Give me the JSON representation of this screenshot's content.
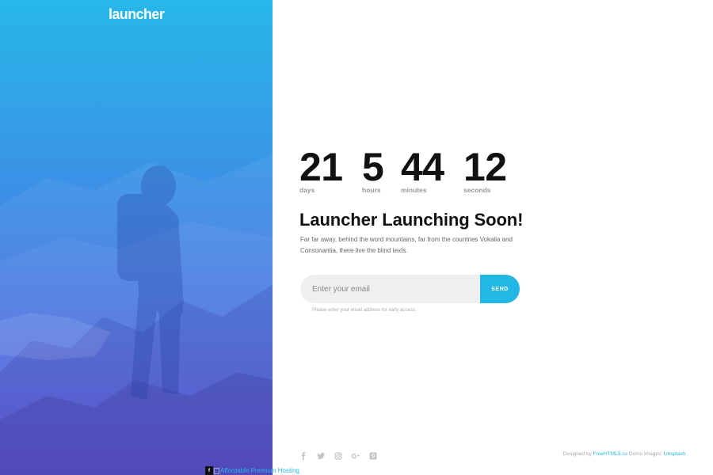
{
  "brand": {
    "logo": "launcher"
  },
  "countdown": {
    "days": {
      "value": "21",
      "label": "days"
    },
    "hours": {
      "value": "5",
      "label": "hours"
    },
    "minutes": {
      "value": "44",
      "label": "minutes"
    },
    "seconds": {
      "value": "12",
      "label": "seconds"
    }
  },
  "headline": "Launcher Launching Soon!",
  "description": "Far far away, behind the word mountains, far from the countries Vokalia and Consonantia, there live the blind texts.",
  "form": {
    "email_placeholder": "Enter your email",
    "send_label": "SEND",
    "hint": "Please enter your email address for early access."
  },
  "social": [
    "facebook-icon",
    "twitter-icon",
    "instagram-icon",
    "google-plus-icon",
    "pinterest-icon"
  ],
  "footer": {
    "designed_by": "Designed by",
    "designer_link": "FreeHTML5.co",
    "demo_images": "Demo Images:",
    "images_link": "Unsplash"
  },
  "ad": {
    "badge": "f",
    "alt_text": "Affordable Premium Hosting"
  },
  "colors": {
    "accent": "#23b7e5",
    "gradient_top": "#27b8e8",
    "gradient_bottom": "#5748d8"
  }
}
